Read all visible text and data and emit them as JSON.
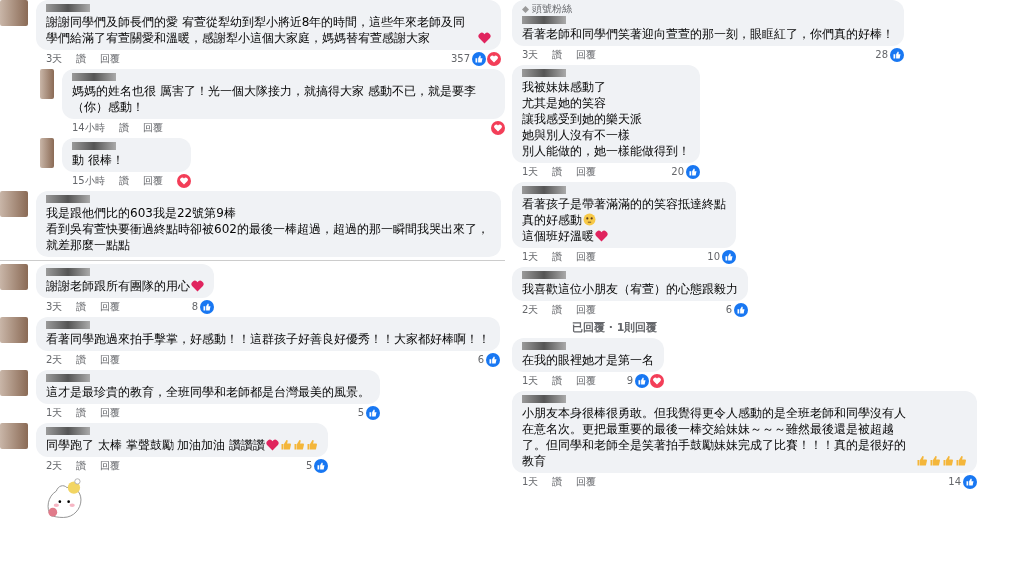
{
  "columns": [
    {
      "show_avatars": true,
      "comments": [
        {
          "reply": false,
          "lines": [
            {
              "text": "謝謝同學們及師長們的愛 宥萱從犁幼到犁小將近8年的時間，這些年來老師及同學們給滿了宥萱關愛和溫暖，感謝犁小這個大家庭，媽媽替宥萱感謝大家",
              "emoji": [
                {
                  "kind": "heart"
                }
              ]
            }
          ],
          "meta": {
            "time": "3天",
            "like": "讚",
            "reply": "回覆"
          },
          "reactions": {
            "count": "357",
            "like": true,
            "love": true
          },
          "sticker": false,
          "divider_after": false
        },
        {
          "reply": true,
          "lines": [
            {
              "text": "媽媽的姓名也很 厲害了！光一個大隊接力，就搞得大家 感動不已，就是要李（你）感動！"
            }
          ],
          "meta": {
            "time": "14小時",
            "like": "讚",
            "reply": "回覆"
          },
          "reactions": {
            "like": false,
            "love": true
          },
          "sticker": false,
          "divider_after": false
        },
        {
          "reply": true,
          "lines": [
            {
              "text": "動 很棒！"
            }
          ],
          "meta": {
            "time": "15小時",
            "like": "讚",
            "reply": "回覆"
          },
          "reactions": {
            "like": false,
            "love": true
          },
          "sticker": false,
          "divider_after": false
        },
        {
          "reply": false,
          "lines": [
            {
              "text": "我是跟他們比的603我是22號第9棒"
            },
            {
              "text": "看到吳宥萱快要衝過終點時卻被602的最後一棒超過，超過的那一瞬間我哭出來了，就差那麼一點點"
            }
          ],
          "sticker": false,
          "divider_after": true
        },
        {
          "reply": false,
          "lines": [
            {
              "text": "謝謝老師跟所有團隊的用心",
              "emoji": [
                {
                  "kind": "heart"
                }
              ]
            }
          ],
          "meta": {
            "time": "3天",
            "like": "讚",
            "reply": "回覆"
          },
          "reactions": {
            "count": "8",
            "like": true,
            "love": false
          },
          "sticker": false,
          "divider_after": false
        },
        {
          "reply": false,
          "lines": [
            {
              "text": "看著同學跑過來拍手擊掌，好感動！！這群孩子好善良好優秀！！大家都好棒啊！！"
            }
          ],
          "meta": {
            "time": "2天",
            "like": "讚",
            "reply": "回覆"
          },
          "reactions": {
            "count": "6",
            "like": true,
            "love": false
          },
          "sticker": false,
          "divider_after": false
        },
        {
          "reply": false,
          "lines": [
            {
              "text": "這才是最珍貴的教育，全班同學和老師都是台灣最美的風景。"
            }
          ],
          "meta": {
            "time": "1天",
            "like": "讚",
            "reply": "回覆"
          },
          "reactions": {
            "count": "5",
            "like": true,
            "love": false
          },
          "sticker": false,
          "divider_after": false
        },
        {
          "reply": false,
          "lines": [
            {
              "text": "同學跑了 太棒 掌聲鼓勵 加油加油 讚讚讚",
              "emoji": [
                {
                  "kind": "heart"
                },
                {
                  "kind": "thumb"
                },
                {
                  "kind": "thumb"
                },
                {
                  "kind": "thumb"
                }
              ]
            }
          ],
          "meta": {
            "time": "2天",
            "like": "讚",
            "reply": "回覆"
          },
          "reactions": {
            "count": "5",
            "like": true,
            "love": false
          },
          "sticker": true,
          "divider_after": false
        }
      ]
    },
    {
      "show_avatars": false,
      "comments": [
        {
          "reply": false,
          "badge": "頭號粉絲",
          "lines": [
            {
              "text": "看著老師和同學們笑著迎向萱萱的那一刻，眼眶紅了，你們真的好棒！"
            }
          ],
          "meta": {
            "time": "3天",
            "like": "讚",
            "reply": "回覆"
          },
          "reactions": {
            "count": "28",
            "like": true,
            "love": false
          },
          "sticker": false,
          "divider_after": false
        },
        {
          "reply": false,
          "lines": [
            {
              "text": "我被妹妹感動了"
            },
            {
              "text": "尤其是她的笑容"
            },
            {
              "text": "讓我感受到她的樂天派"
            },
            {
              "text": "她與別人沒有不一樣"
            },
            {
              "text": "別人能做的，她一樣能做得到！"
            }
          ],
          "meta": {
            "time": "1天",
            "like": "讚",
            "reply": "回覆"
          },
          "reactions": {
            "count": "20",
            "like": true,
            "love": false
          },
          "sticker": false,
          "divider_after": false
        },
        {
          "reply": false,
          "lines": [
            {
              "text": "看著孩子是帶著滿滿的的笑容抵達終點"
            },
            {
              "text": "真的好感動",
              "emoji": [
                {
                  "kind": "teary"
                }
              ]
            },
            {
              "text": "這個班好溫暖",
              "emoji": [
                {
                  "kind": "heart"
                }
              ]
            }
          ],
          "meta": {
            "time": "1天",
            "like": "讚",
            "reply": "回覆"
          },
          "reactions": {
            "count": "10",
            "like": true,
            "love": false
          },
          "sticker": false,
          "divider_after": false
        },
        {
          "reply": false,
          "lines": [
            {
              "text": "我喜歡這位小朋友（宥萱）的心態跟毅力"
            }
          ],
          "meta": {
            "time": "2天",
            "like": "讚",
            "reply": "回覆"
          },
          "reactions": {
            "count": "6",
            "like": true,
            "love": false
          },
          "sticker": false,
          "divider_after": false,
          "more_replies": "已回覆 · 1則回覆"
        },
        {
          "reply": false,
          "lines": [
            {
              "text": "在我的眼裡她才是第一名"
            }
          ],
          "meta": {
            "time": "1天",
            "like": "讚",
            "reply": "回覆"
          },
          "reactions": {
            "count": "9",
            "like": true,
            "love": true
          },
          "sticker": false,
          "divider_after": false
        },
        {
          "reply": false,
          "lines": [
            {
              "text": "小朋友本身很棒很勇敢。但我覺得更令人感動的是全班老師和同學沒有人在意名次。更把最重要的最後一棒交給妹妹～～～雖然最後還是被超越了。但同學和老師全是笑著拍手鼓勵妹妹完成了比賽！！！真的是很好的教育",
              "emoji": [
                {
                  "kind": "thumb"
                },
                {
                  "kind": "thumb"
                },
                {
                  "kind": "thumb"
                },
                {
                  "kind": "thumb"
                }
              ]
            }
          ],
          "meta": {
            "time": "1天",
            "like": "讚",
            "reply": "回覆"
          },
          "reactions": {
            "count": "14",
            "like": true,
            "love": false
          },
          "sticker": false,
          "divider_after": false
        }
      ]
    }
  ]
}
